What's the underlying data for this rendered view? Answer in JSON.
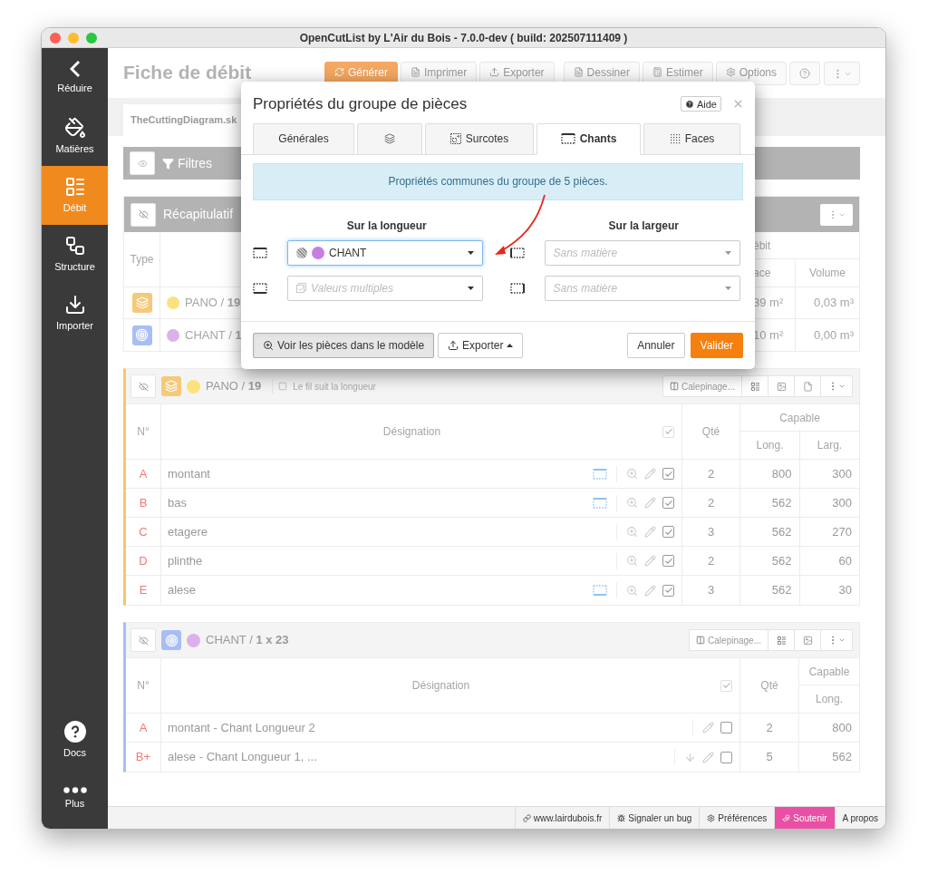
{
  "window": {
    "title": "OpenCutList by L'Air du Bois - 7.0.0-dev ( build: 202507111409 )"
  },
  "sidebar": {
    "items": [
      {
        "label": "Réduire",
        "selected": false
      },
      {
        "label": "Matières",
        "selected": false
      },
      {
        "label": "Débit",
        "selected": true
      },
      {
        "label": "Structure",
        "selected": false
      },
      {
        "label": "Importer",
        "selected": false
      }
    ],
    "bottom_items": [
      {
        "label": "Docs"
      },
      {
        "label": "Plus"
      }
    ]
  },
  "header": {
    "title": "Fiche de débit",
    "buttons": [
      {
        "label": "Générer",
        "primary": true
      },
      {
        "label": "Imprimer",
        "primary": false
      },
      {
        "label": "Exporter",
        "primary": false
      },
      {
        "label": "Dessiner",
        "primary": false
      },
      {
        "label": "Estimer",
        "primary": false
      },
      {
        "label": "Options",
        "primary": false
      }
    ]
  },
  "document_tab": {
    "label": "TheCuttingDiagram.sk"
  },
  "filters": {
    "label": "Filtres"
  },
  "summary": {
    "title": "Récapitulatif",
    "columns": {
      "type": "Type",
      "group": "ébit",
      "area": "ace",
      "volume": "Volume"
    },
    "rows": [
      {
        "kind": "sheet",
        "color": "#fbe27c",
        "name": "PANO / **19**",
        "area": "39 m²",
        "volume": "0,03 m³"
      },
      {
        "kind": "edge",
        "color": "#dcb1ea",
        "name": "CHANT / **1**",
        "area": "10 m²",
        "volume": "0,00 m³"
      }
    ]
  },
  "groups": [
    {
      "kind": "sheet",
      "color": "#fbe27c",
      "title": "PANO / **19**",
      "grain": "Le fil suit la longueur",
      "layout_button": "Calepinage...",
      "columns": {
        "number": "N°",
        "name": "Désignation",
        "qty": "Qté",
        "capable": "Capable",
        "dims": [
          "Long.",
          "Larg."
        ]
      },
      "header_checked": true,
      "rows": [
        {
          "number": "A",
          "name": "montant",
          "edge_top": true,
          "edge_bottom": false,
          "arrow": false,
          "checked": true,
          "qty": "2",
          "dims": [
            "800",
            "300"
          ]
        },
        {
          "number": "B",
          "name": "bas",
          "edge_top": true,
          "edge_bottom": false,
          "arrow": false,
          "checked": true,
          "qty": "2",
          "dims": [
            "562",
            "300"
          ]
        },
        {
          "number": "C",
          "name": "etagere",
          "edge_top": false,
          "edge_bottom": false,
          "arrow": false,
          "checked": true,
          "qty": "3",
          "dims": [
            "562",
            "270"
          ]
        },
        {
          "number": "D",
          "name": "plinthe",
          "edge_top": false,
          "edge_bottom": false,
          "arrow": false,
          "checked": true,
          "qty": "2",
          "dims": [
            "562",
            "60"
          ]
        },
        {
          "number": "E",
          "name": "alese",
          "edge_top": false,
          "edge_bottom": true,
          "arrow": false,
          "checked": true,
          "qty": "3",
          "dims": [
            "562",
            "30"
          ]
        }
      ]
    },
    {
      "kind": "edge",
      "color": "#dcb1ea",
      "title": "CHANT / **1 x 23**",
      "layout_button": "Calepinage...",
      "columns": {
        "number": "N°",
        "name": "Désignation",
        "qty": "Qté",
        "capable": "Capable",
        "dims": [
          "Long."
        ]
      },
      "header_checked": true,
      "rows": [
        {
          "number": "A",
          "name": "montant - Chant Longueur 2",
          "edge_top": false,
          "edge_bottom": false,
          "arrow": false,
          "checked": false,
          "qty": "2",
          "dims": [
            "800"
          ]
        },
        {
          "number": "B+",
          "name": "alese - Chant Longueur 1, ...",
          "edge_top": false,
          "edge_bottom": false,
          "arrow": true,
          "checked": false,
          "qty": "5",
          "dims": [
            "562"
          ]
        }
      ]
    }
  ],
  "modal": {
    "title": "Propriétés du groupe de pièces",
    "help": "Aide",
    "tabs": [
      {
        "label": "Générales",
        "selected": false
      },
      {
        "selected": false
      },
      {
        "label": "Surcotes",
        "selected": false
      },
      {
        "label": "Chants",
        "selected": true
      },
      {
        "label": "Faces",
        "selected": false
      }
    ],
    "info": "Propriétés communes du groupe de 5 pièces.",
    "headings": [
      "Sur la longueur",
      "Sur la largeur"
    ],
    "fields": [
      {
        "kind": "value",
        "value": "CHANT",
        "color": "#c77ee0",
        "focused": true
      },
      {
        "kind": "empty",
        "placeholder": "Sans matière",
        "focused": false
      },
      {
        "kind": "multiple",
        "placeholder": "Valeurs multiples",
        "focused": false
      },
      {
        "kind": "empty",
        "placeholder": "Sans matière",
        "focused": false
      }
    ],
    "buttons": [
      {
        "label": "Voir les pièces dans le modèle",
        "kind": "pressed"
      },
      {
        "label": "Exporter",
        "kind": "menu"
      },
      {
        "label": "Annuler",
        "kind": "default"
      },
      {
        "label": "Valider",
        "kind": "primary"
      }
    ]
  },
  "status_bar": {
    "items": [
      {
        "label": "www.lairdubois.fr",
        "highlighted": false
      },
      {
        "label": "Signaler un bug",
        "highlighted": false
      },
      {
        "label": "Préférences",
        "highlighted": false
      },
      {
        "label": "Soutenir",
        "highlighted": true
      },
      {
        "label": "A propos",
        "highlighted": false
      }
    ]
  }
}
